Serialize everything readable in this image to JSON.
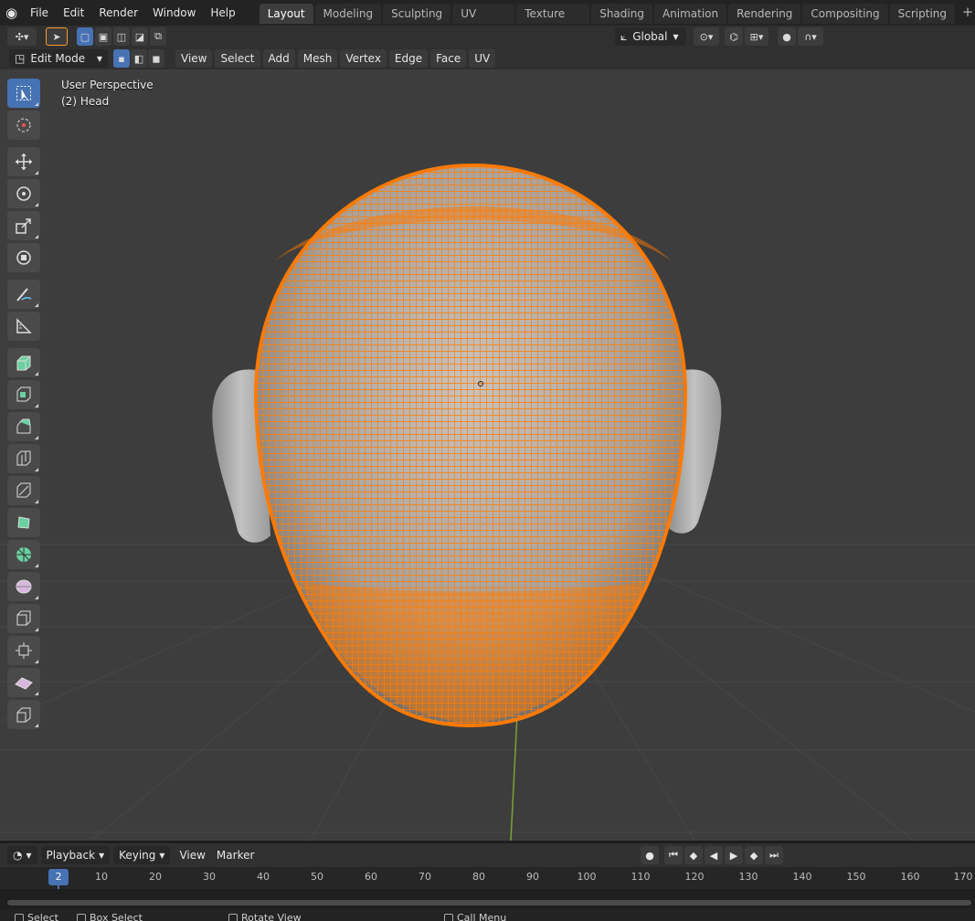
{
  "menu": [
    "File",
    "Edit",
    "Render",
    "Window",
    "Help"
  ],
  "workspace_tabs": [
    "Layout",
    "Modeling",
    "Sculpting",
    "UV Editing",
    "Texture Paint",
    "Shading",
    "Animation",
    "Rendering",
    "Compositing",
    "Scripting"
  ],
  "active_tab": "Layout",
  "header": {
    "orientation": "Global"
  },
  "mode": {
    "label": "Edit Mode"
  },
  "viewport_menus": [
    "View",
    "Select",
    "Add",
    "Mesh",
    "Vertex",
    "Edge",
    "Face",
    "UV"
  ],
  "viewport": {
    "perspective": "User Perspective",
    "object": "(2) Head"
  },
  "timeline": {
    "playback": "Playback",
    "keying": "Keying",
    "view": "View",
    "marker": "Marker",
    "current_frame": "2",
    "ticks": [
      "10",
      "20",
      "30",
      "40",
      "50",
      "60",
      "70",
      "80",
      "90",
      "100",
      "110",
      "120",
      "130",
      "140",
      "150",
      "160",
      "170"
    ]
  },
  "status": {
    "select": "Select",
    "box_select": "Box Select",
    "rotate_view": "Rotate View",
    "call_menu": "Call Menu"
  },
  "colors": {
    "accent": "#4772b3",
    "selection": "#ff7a00",
    "mesh": "#a7a7a7"
  }
}
